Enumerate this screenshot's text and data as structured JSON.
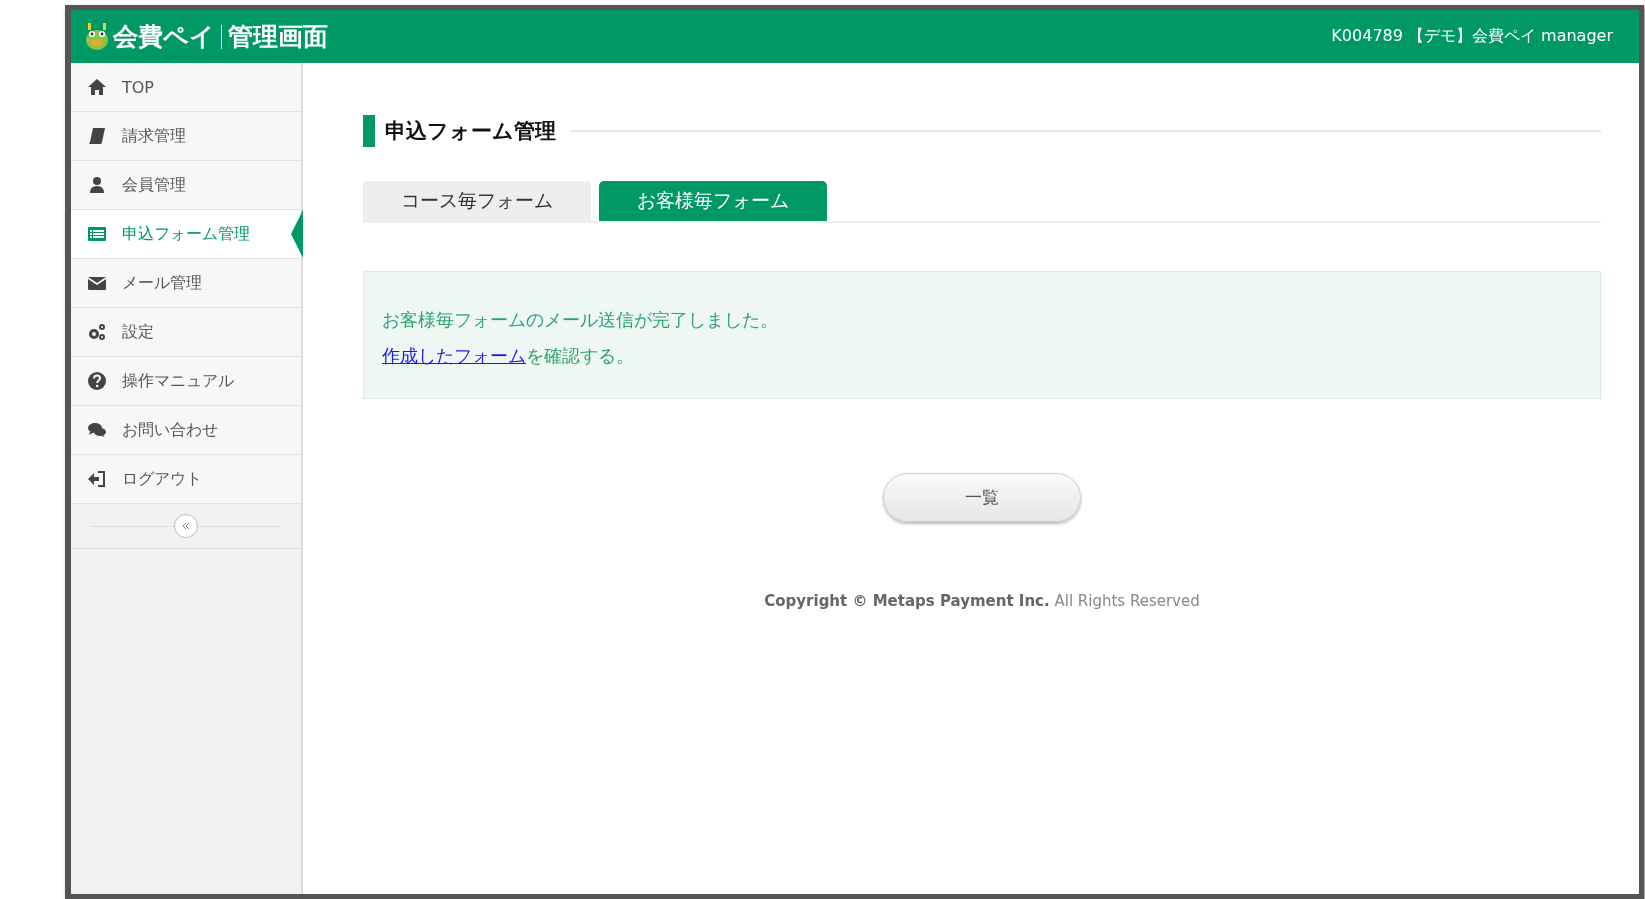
{
  "header": {
    "logo_text": "会費ペイ",
    "title": "管理画面",
    "account": "K004789 【デモ】会費ペイ manager"
  },
  "sidebar": {
    "items": [
      {
        "label": "TOP",
        "selected": false
      },
      {
        "label": "請求管理",
        "selected": false
      },
      {
        "label": "会員管理",
        "selected": false
      },
      {
        "label": "申込フォーム管理",
        "selected": true
      },
      {
        "label": "メール管理",
        "selected": false
      },
      {
        "label": "設定",
        "selected": false
      },
      {
        "label": "操作マニュアル",
        "selected": false
      },
      {
        "label": "お問い合わせ",
        "selected": false
      },
      {
        "label": "ログアウト",
        "selected": false
      }
    ]
  },
  "page_title": "申込フォーム管理",
  "tabs": [
    {
      "label": "コース毎フォーム",
      "selected": false
    },
    {
      "label": "お客様毎フォーム",
      "selected": true
    }
  ],
  "alert": {
    "message": "お客様毎フォームのメール送信が完了しました。",
    "link": "作成したフォーム",
    "link_suffix": "を確認する。"
  },
  "list_button": "一覧",
  "copyright": "**Copyright © Metaps Payment Inc.** All Rights Reserved"
}
